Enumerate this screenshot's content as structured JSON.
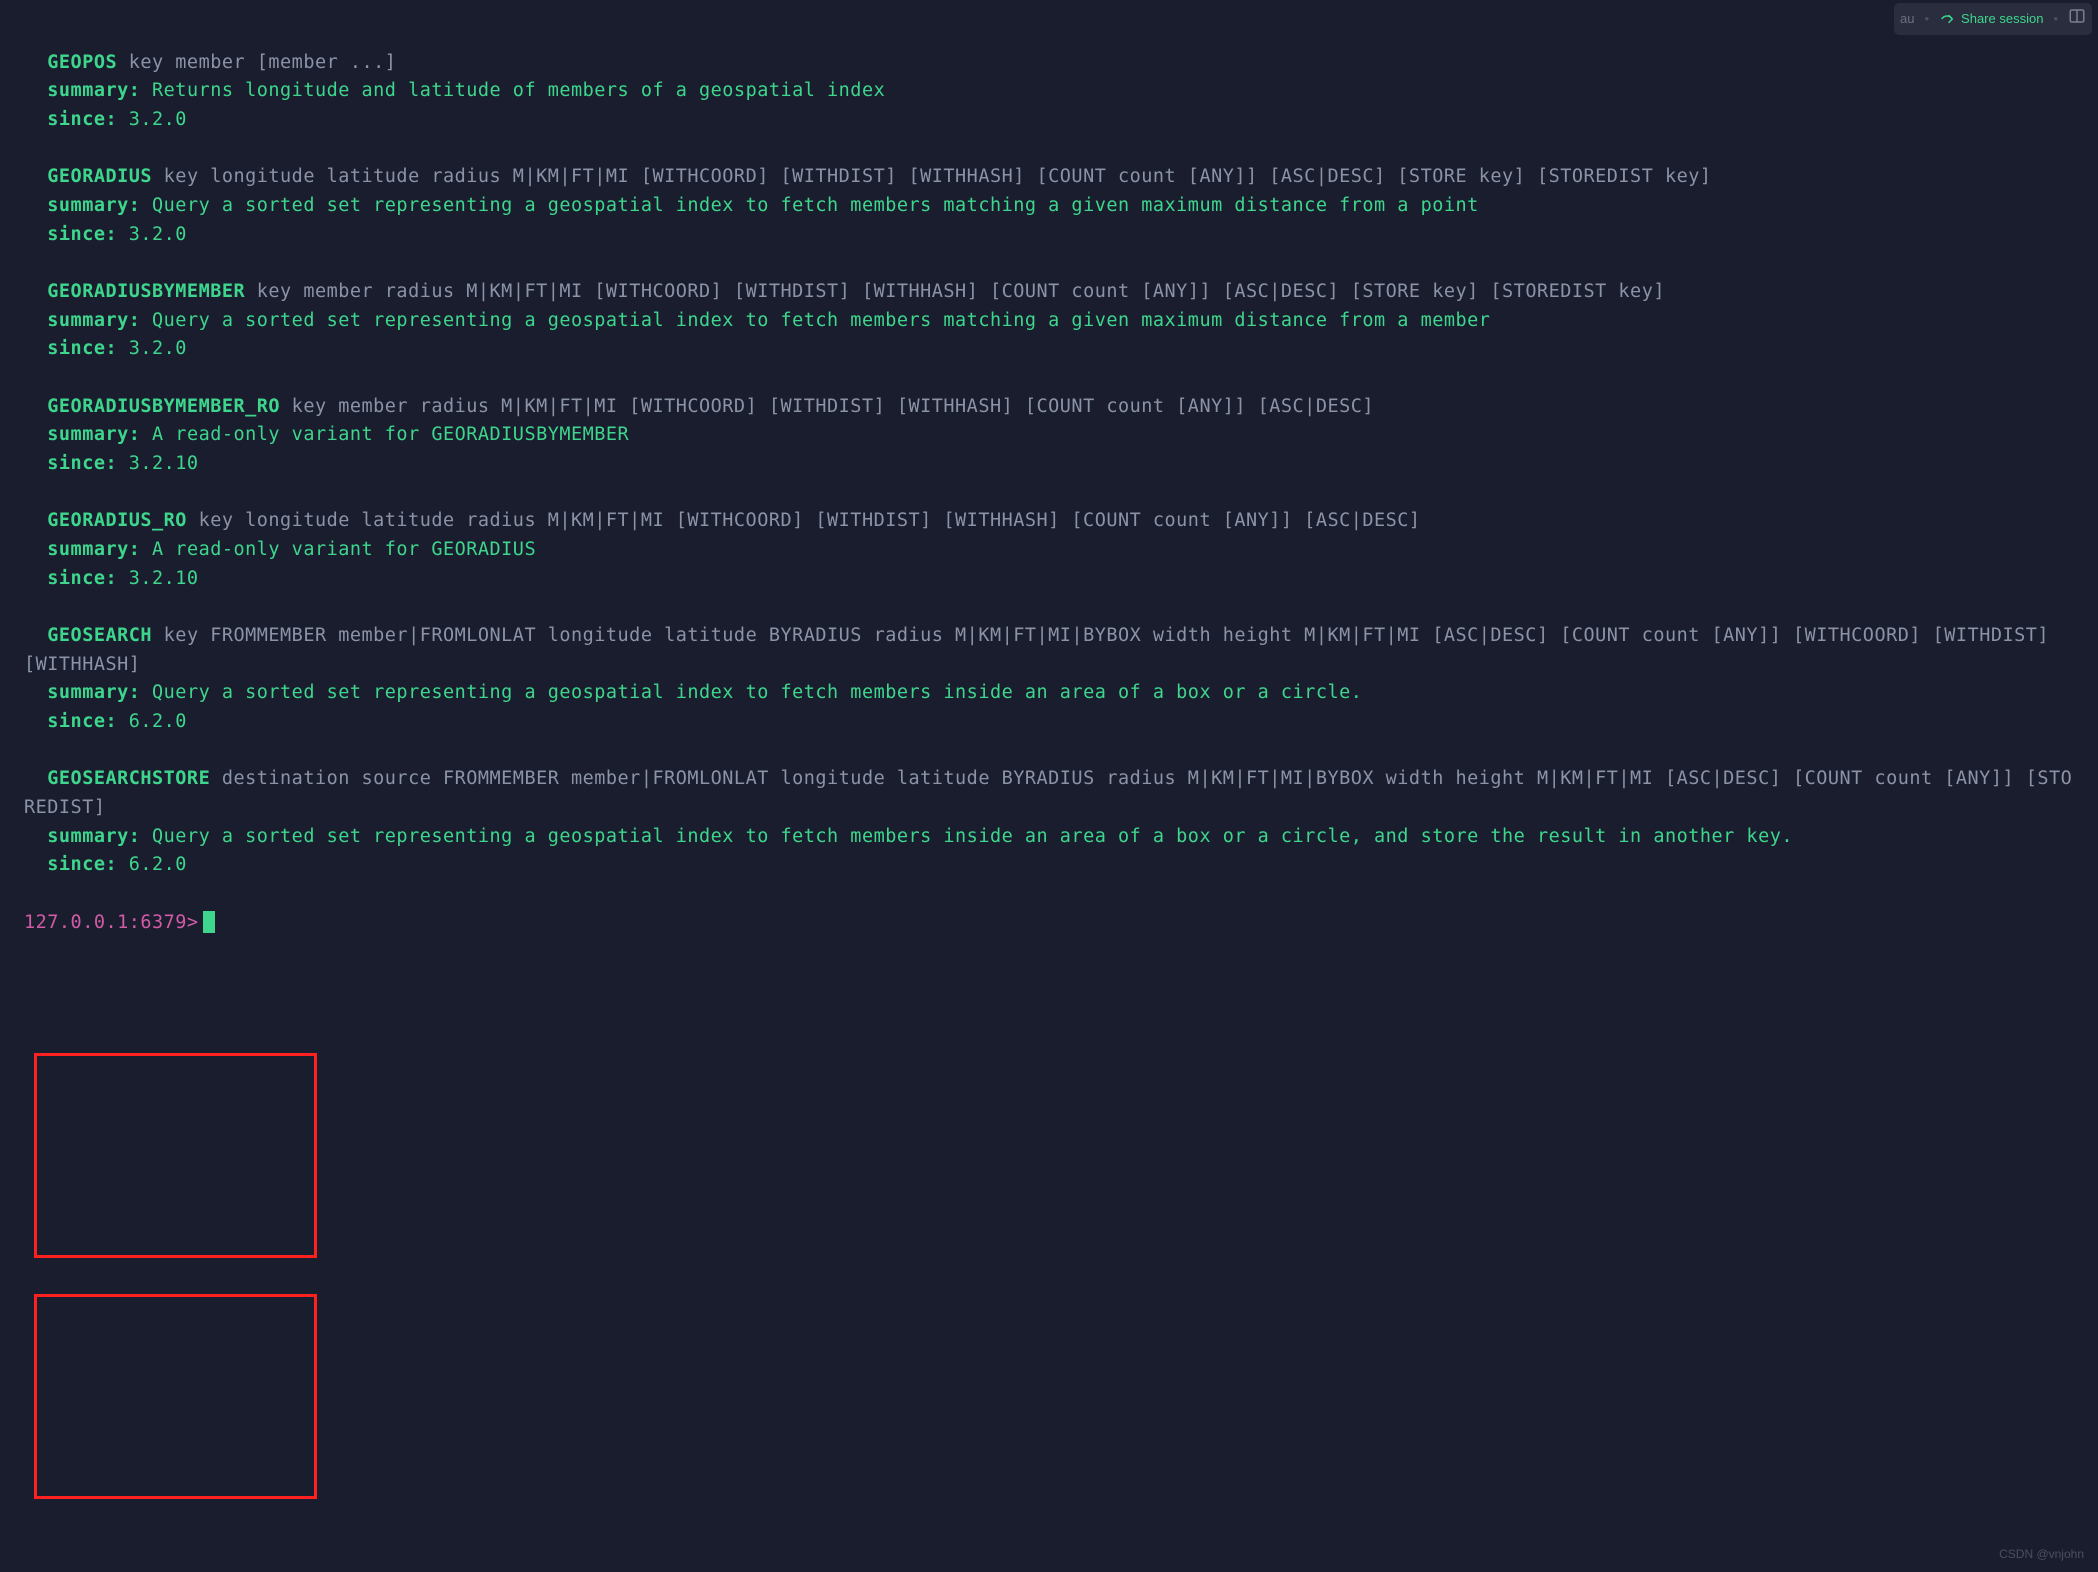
{
  "toolbar": {
    "au": "au",
    "share": "Share session"
  },
  "commands": [
    {
      "name": "GEOPOS",
      "args": "key member [member ...]",
      "summary": "Returns longitude and latitude of members of a geospatial index",
      "since": "3.2.0"
    },
    {
      "name": "GEORADIUS",
      "args": "key longitude latitude radius M|KM|FT|MI [WITHCOORD] [WITHDIST] [WITHHASH] [COUNT count [ANY]] [ASC|DESC] [STORE key] [STOREDIST key]",
      "summary": "Query a sorted set representing a geospatial index to fetch members matching a given maximum distance from a point",
      "since": "3.2.0"
    },
    {
      "name": "GEORADIUSBYMEMBER",
      "args": "key member radius M|KM|FT|MI [WITHCOORD] [WITHDIST] [WITHHASH] [COUNT count [ANY]] [ASC|DESC] [STORE key] [STOREDIST key]",
      "summary": "Query a sorted set representing a geospatial index to fetch members matching a given maximum distance from a member",
      "since": "3.2.0"
    },
    {
      "name": "GEORADIUSBYMEMBER_RO",
      "args": "key member radius M|KM|FT|MI [WITHCOORD] [WITHDIST] [WITHHASH] [COUNT count [ANY]] [ASC|DESC]",
      "summary": "A read-only variant for GEORADIUSBYMEMBER",
      "since": "3.2.10"
    },
    {
      "name": "GEORADIUS_RO",
      "args": "key longitude latitude radius M|KM|FT|MI [WITHCOORD] [WITHDIST] [WITHHASH] [COUNT count [ANY]] [ASC|DESC]",
      "summary": "A read-only variant for GEORADIUS",
      "since": "3.2.10"
    },
    {
      "name": "GEOSEARCH",
      "args": "key FROMMEMBER member|FROMLONLAT longitude latitude BYRADIUS radius M|KM|FT|MI|BYBOX width height M|KM|FT|MI [ASC|DESC] [COUNT count [ANY]] [WITHCOORD] [WITHDIST] [WITHHASH]",
      "summary": "Query a sorted set representing a geospatial index to fetch members inside an area of a box or a circle.",
      "since": "6.2.0"
    },
    {
      "name": "GEOSEARCHSTORE",
      "args": "destination source FROMMEMBER member|FROMLONLAT longitude latitude BYRADIUS radius M|KM|FT|MI|BYBOX width height M|KM|FT|MI [ASC|DESC] [COUNT count [ANY]] [STOREDIST]",
      "summary": "Query a sorted set representing a geospatial index to fetch members inside an area of a box or a circle, and store the result in another key.",
      "since": "6.2.0"
    }
  ],
  "labels": {
    "summary": "summary:",
    "since": "since:"
  },
  "prompt": "127.0.0.1:6379>",
  "watermark": "CSDN @vnjohn"
}
